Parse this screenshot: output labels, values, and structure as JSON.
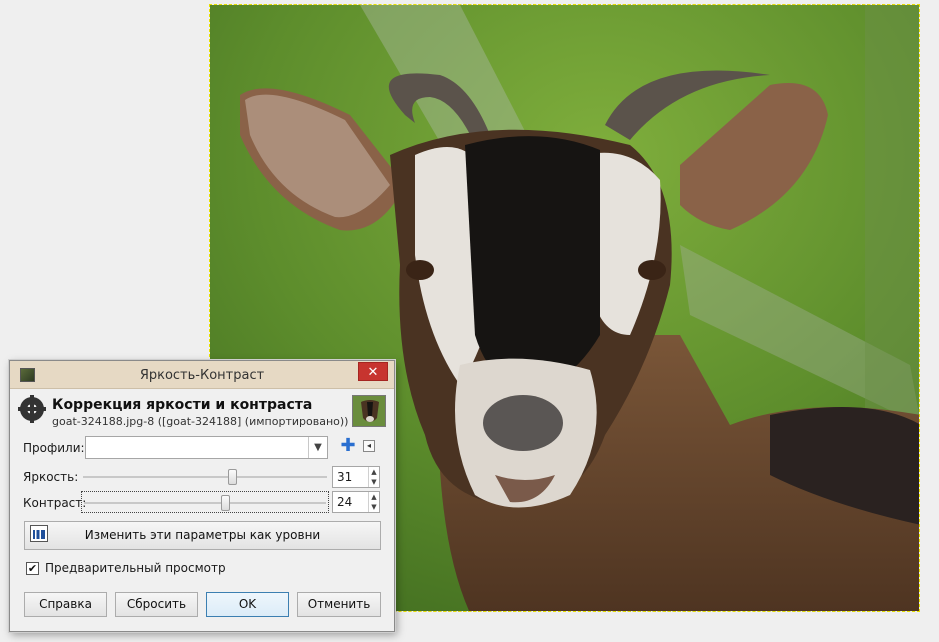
{
  "dialog": {
    "window_title": "Яркость-Контраст",
    "close_label": "✕",
    "header_title": "Коррекция яркости и контраста",
    "header_subtitle": "goat-324188.jpg-8 ([goat-324188] (импортировано))",
    "profiles_label": "Профили:",
    "profiles_value": "",
    "plus_label": "✚",
    "menu_label": "◂",
    "brightness_label": "Яркость:",
    "brightness_value": "31",
    "brightness_fraction": 0.62,
    "contrast_label": "Контраст:",
    "contrast_value": "24",
    "contrast_fraction": 0.59,
    "levels_button": "Изменить эти параметры как уровни",
    "preview_label": "Предварительный просмотр",
    "preview_checked": true,
    "buttons": {
      "help": "Справка",
      "reset": "Сбросить",
      "ok": "OK",
      "cancel": "Отменить"
    }
  }
}
